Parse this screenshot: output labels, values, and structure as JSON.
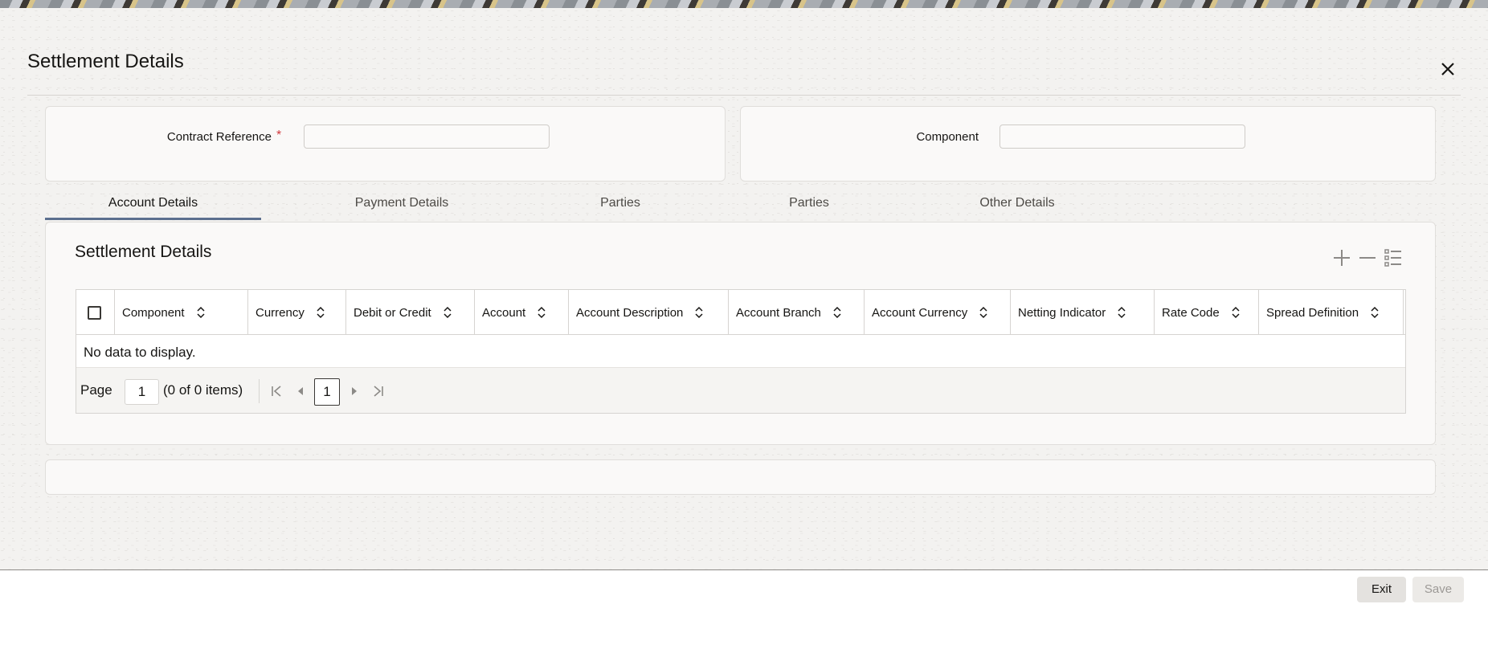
{
  "dialog": {
    "title": "Settlement Details",
    "close_icon": "close-icon"
  },
  "header_fields": {
    "contract_reference_label": "Contract Reference",
    "contract_reference_required": "*",
    "contract_reference_value": "",
    "component_label": "Component",
    "component_value": ""
  },
  "tabs": [
    {
      "label": "Account Details",
      "active": true
    },
    {
      "label": "Payment Details",
      "active": false
    },
    {
      "label": "Parties",
      "active": false
    },
    {
      "label": "Parties",
      "active": false
    },
    {
      "label": "Other Details",
      "active": false
    }
  ],
  "section": {
    "title": "Settlement Details",
    "toolbar_icons": [
      "add-icon",
      "remove-icon",
      "list-view-icon"
    ]
  },
  "grid": {
    "columns": [
      "Component",
      "Currency",
      "Debit or Credit",
      "Account",
      "Account Description",
      "Account Branch",
      "Account Currency",
      "Netting Indicator",
      "Rate Code",
      "Spread Definition"
    ],
    "empty_message": "No data to display.",
    "pager": {
      "page_label": "Page",
      "page_value": "1",
      "items_summary": "(0 of 0 items)",
      "current_page": "1"
    }
  },
  "footer": {
    "exit_label": "Exit",
    "save_label": "Save"
  },
  "colors": {
    "accent_underline": "#5b6f8e",
    "required_marker": "#d1383d"
  }
}
